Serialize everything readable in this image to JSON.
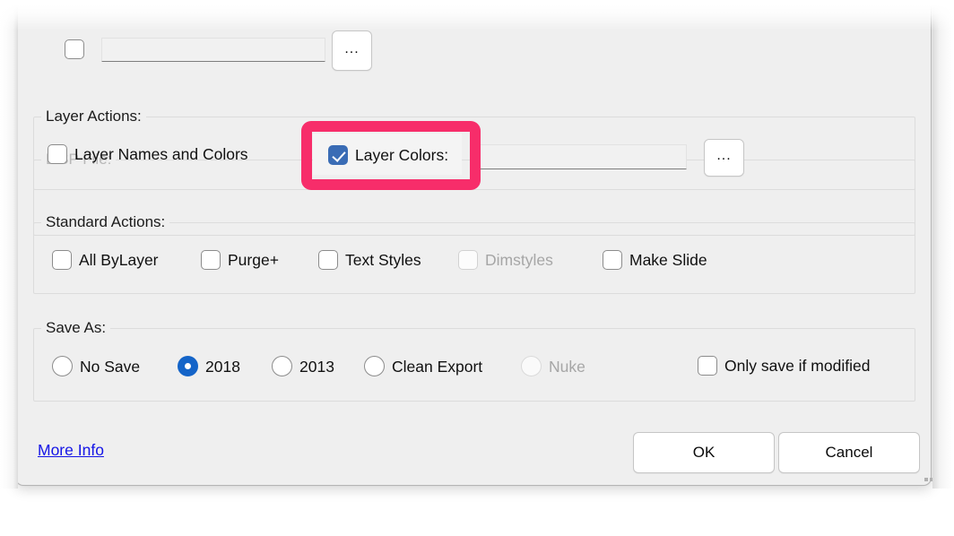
{
  "window": {
    "title_hidden": true
  },
  "lisp_section": {
    "legend": "LISP File:",
    "checkbox_checked": false,
    "input_value": "",
    "browse_label": "..."
  },
  "layer_actions": {
    "legend": "Layer Actions:",
    "items": [
      {
        "label": "Layer Names and Colors",
        "checked": false,
        "disabled": false
      },
      {
        "label": "Layer Colors:",
        "checked": true,
        "disabled": false
      }
    ],
    "input_value": "",
    "browse_label": "..."
  },
  "standard_actions": {
    "legend": "Standard Actions:",
    "items": [
      {
        "label": "All ByLayer",
        "checked": false,
        "disabled": false
      },
      {
        "label": "Purge+",
        "checked": false,
        "disabled": false
      },
      {
        "label": "Text Styles",
        "checked": false,
        "disabled": false
      },
      {
        "label": "Dimstyles",
        "checked": false,
        "disabled": true
      },
      {
        "label": "Make Slide",
        "checked": false,
        "disabled": false
      }
    ]
  },
  "save_as": {
    "legend": "Save As:",
    "options": [
      {
        "label": "No Save",
        "selected": false,
        "disabled": false
      },
      {
        "label": "2018",
        "selected": true,
        "disabled": false
      },
      {
        "label": "2013",
        "selected": false,
        "disabled": false
      },
      {
        "label": "Clean Export",
        "selected": false,
        "disabled": false
      },
      {
        "label": "Nuke",
        "selected": false,
        "disabled": true
      }
    ],
    "only_save_if_modified": {
      "label": "Only save if modified",
      "checked": false
    }
  },
  "footer": {
    "more_info_label": "More Info",
    "ok_label": "OK",
    "cancel_label": "Cancel"
  },
  "annotation": {
    "target": "Layer Colors:",
    "highlight_color": "#f72d6a"
  },
  "colors": {
    "dialog_background": "#efefef",
    "accent_checkbox": "#3a6cb5",
    "accent_radio": "#1464c8",
    "link": "#1414e6",
    "disabled_text": "#a6a6a6"
  }
}
